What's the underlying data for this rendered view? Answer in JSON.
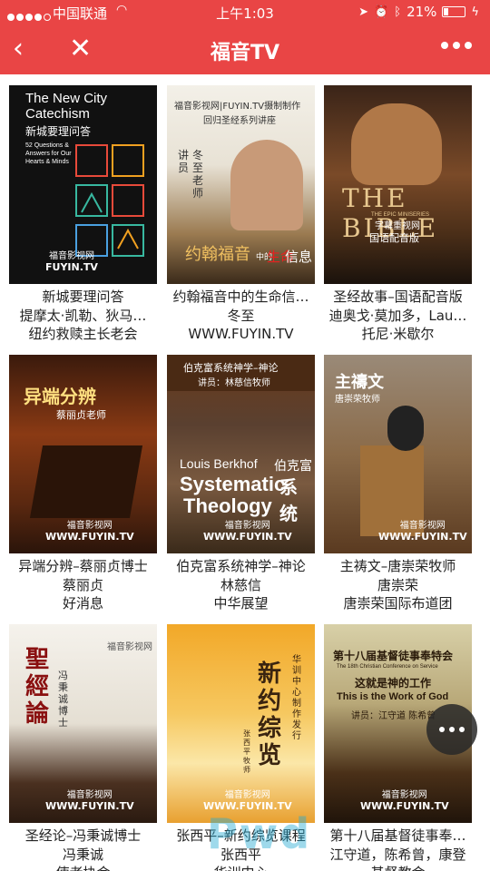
{
  "status_bar": {
    "carrier": "中国联通",
    "time": "上午1:03",
    "battery": "21%",
    "battery_level": 0.21
  },
  "nav": {
    "title": "福音TV"
  },
  "items": [
    {
      "title": "新城要理问答",
      "speaker": "提摩太·凯勒、狄马…",
      "source": "纽约救赎主长老会",
      "cover": {
        "line1": "The New City",
        "line2": "Catechism",
        "line3": "新城要理问答",
        "line4": "52 Questions & Answers for Our Hearts & Minds",
        "logo_cn": "福音影视网",
        "logo_en": "FUYIN.TV"
      }
    },
    {
      "title": "约翰福音中的生命信…",
      "speaker": "冬至",
      "source": "WWW.FUYIN.TV",
      "cover": {
        "line1": "福音影视网|FUYIN.TV摄制制作",
        "line2": "回归圣经系列讲座",
        "line3": "讲员",
        "line4": "冬至老师",
        "line5": "约翰福音",
        "line6": "中的",
        "line7": "生命",
        "line8": "信息"
      }
    },
    {
      "title": "圣经故事–国语配音版",
      "speaker": "迪奥戈·莫加多，Lau…",
      "source": "托尼·米歇尔",
      "cover": {
        "line1": "THE BIBLE",
        "line2": "THE EPIC MINISERIES",
        "line3": "字幕重视网",
        "line4": "国语配音版"
      }
    },
    {
      "title": "异端分辨–蔡丽贞博士",
      "speaker": "蔡丽贞",
      "source": "好消息",
      "cover": {
        "line1": "异端分辨",
        "line2": "蔡丽贞老师",
        "logo_cn": "福音影视网",
        "logo_en": "WWW.FUYIN.TV"
      }
    },
    {
      "title": "伯克富系统神学–神论",
      "speaker": "林慈信",
      "source": "中华展望",
      "cover": {
        "line1": "伯克富系统神学–神论",
        "line2": "讲员：林慈信牧师",
        "line3": "Louis Berkhof",
        "line4": "伯克富",
        "line5": "Systematic",
        "line6": "系统",
        "line7": "Theology",
        "logo_cn": "福音影视网",
        "logo_en": "WWW.FUYIN.TV"
      }
    },
    {
      "title": "主祷文–唐崇荣牧师",
      "speaker": "唐崇荣",
      "source": "唐崇荣国际布道团",
      "cover": {
        "line1": "主禱文",
        "line2": "唐崇荣牧师",
        "logo_cn": "福音影视网",
        "logo_en": "WWW.FUYIN.TV"
      }
    },
    {
      "title": "圣经论–冯秉诚博士",
      "speaker": "冯秉诚",
      "source": "使者协会",
      "cover": {
        "line1": "福音影视网",
        "line2": "聖經論",
        "line3": "冯秉诚博士",
        "logo_cn": "福音影视网",
        "logo_en": "WWW.FUYIN.TV"
      }
    },
    {
      "title": "张西平–新约综览课程",
      "speaker": "张西平",
      "source": "华训中心",
      "cover": {
        "line1": "新约综览",
        "line2": "华训中心制作发行",
        "line3": "张西平牧师",
        "logo_cn": "福音影视网",
        "logo_en": "WWW.FUYIN.TV"
      }
    },
    {
      "title": "第十八届基督徒事奉…",
      "speaker": "江守道，陈希曾，康登",
      "source": "基督教会",
      "cover": {
        "line1": "第十八届基督徒事奉特会",
        "line2": "The 18th Christian Conference on Service",
        "line3": "这就是神的工作",
        "line4": "This is the Work of God",
        "line5": "讲员：江守道 陈希曾",
        "logo_cn": "福音影视网",
        "logo_en": "WWW.FUYIN.TV"
      }
    }
  ],
  "watermark": "Pwd"
}
